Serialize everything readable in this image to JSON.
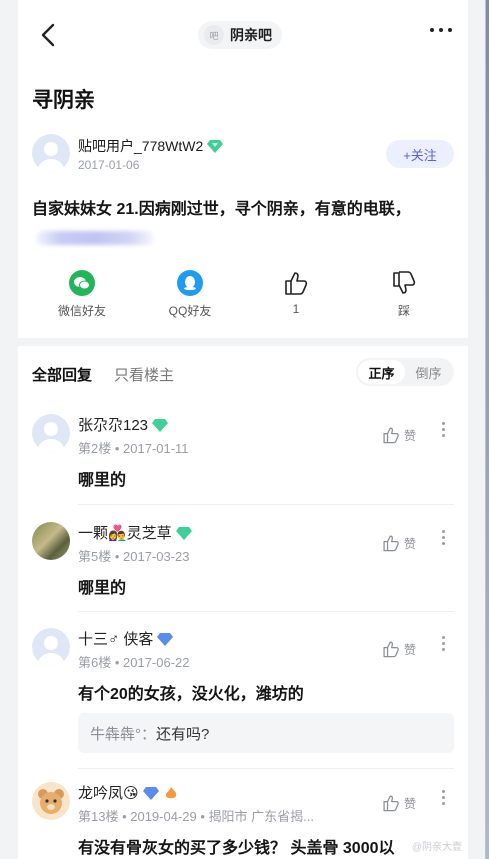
{
  "header": {
    "forum_avatar_text": "吧",
    "forum_name": "阴亲吧"
  },
  "post": {
    "title": "寻阴亲",
    "author": "贴吧用户_778WtW2",
    "date": "2017-01-06",
    "follow_label": "+关注",
    "content": "自家妹妹女 21.因病刚过世，寻个阴亲，有意的电联，",
    "actions": {
      "wechat": "微信好友",
      "qq": "QQ好友",
      "like_count": "1",
      "dislike": "踩"
    }
  },
  "replies": {
    "tab_all": "全部回复",
    "tab_op": "只看楼主",
    "order_asc": "正序",
    "order_desc": "倒序",
    "like_label": "赞",
    "items": [
      {
        "name": "张尕尕123",
        "meta": "第2楼 • 2017-01-11",
        "text": "哪里的"
      },
      {
        "name": "一颗👩‍❤️‍👨灵芝草",
        "meta": "第5楼 • 2017-03-23",
        "text": "哪里的"
      },
      {
        "name": "十三♂ 侠客",
        "meta": "第6楼 • 2017-06-22",
        "text": "有个20的女孩，没火化，潍坊的"
      },
      {
        "name": "龙吟凤😘",
        "meta": "第13楼 • 2019-04-29 • 揭阳市 广东省揭...",
        "text": "有没有骨灰女的买了多少钱？ 头盖骨 3000以"
      }
    ],
    "sub_reply": {
      "who": "牛犇犇°：",
      "text": "还有吗?"
    }
  },
  "watermark": "@阴亲大壹",
  "colors": {
    "accent": "#5b61d6",
    "gem": "#3ecf9a",
    "gem_blue": "#5a8cf0"
  }
}
